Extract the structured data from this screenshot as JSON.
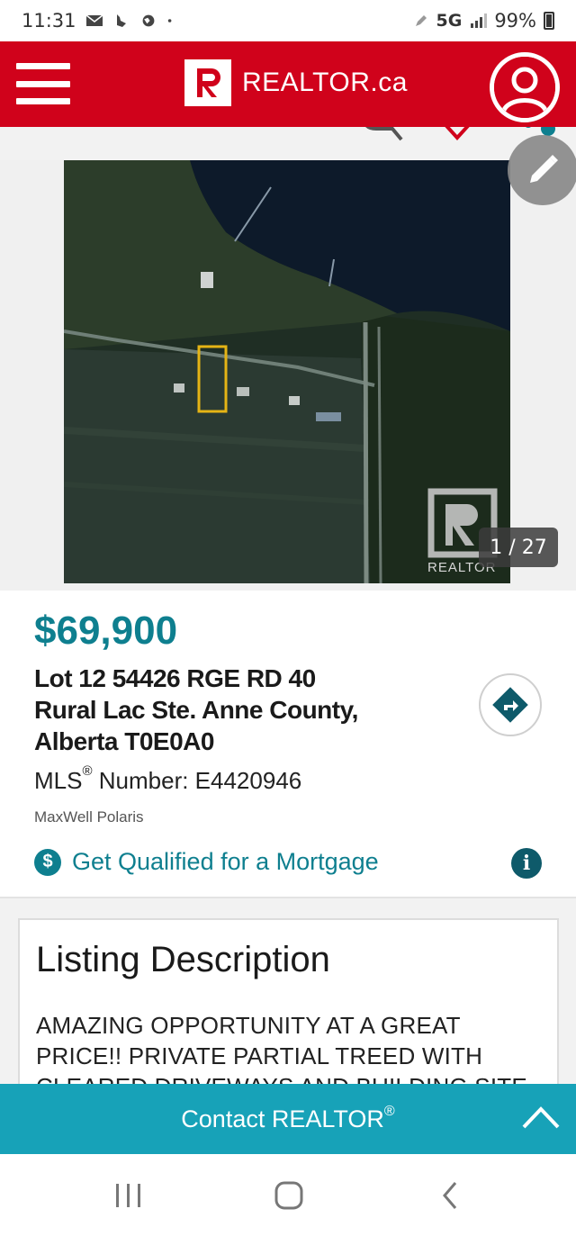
{
  "status_bar": {
    "time": "11:31",
    "network": "5G",
    "battery": "99%"
  },
  "header": {
    "brand_name": "REALTOR.ca",
    "brand_color": "#d0021b"
  },
  "gallery": {
    "counter": "1 / 27",
    "watermark": "REALTOR"
  },
  "listing": {
    "price": "$69,900",
    "address_lines": [
      "Lot 12 54426 RGE RD 40",
      "Rural Lac Ste. Anne County,",
      "Alberta T0E0A0"
    ],
    "mls_prefix": "MLS",
    "mls_reg": "®",
    "mls_suffix": " Number: E4420946",
    "brokerage": "MaxWell Polaris",
    "mortgage_label": "Get Qualified for a Mortgage",
    "accent_color": "#0e7f8f"
  },
  "description": {
    "title": "Listing Description",
    "text": "AMAZING OPPORTUNITY AT A GREAT PRICE!! PRIVATE PARTIAL TREED WITH CLEARED DRIVEWAYS AND BUILDING SITE. THIS HALF"
  },
  "contact": {
    "label": "Contact REALTOR",
    "reg": "®",
    "color": "#17a2b8"
  }
}
